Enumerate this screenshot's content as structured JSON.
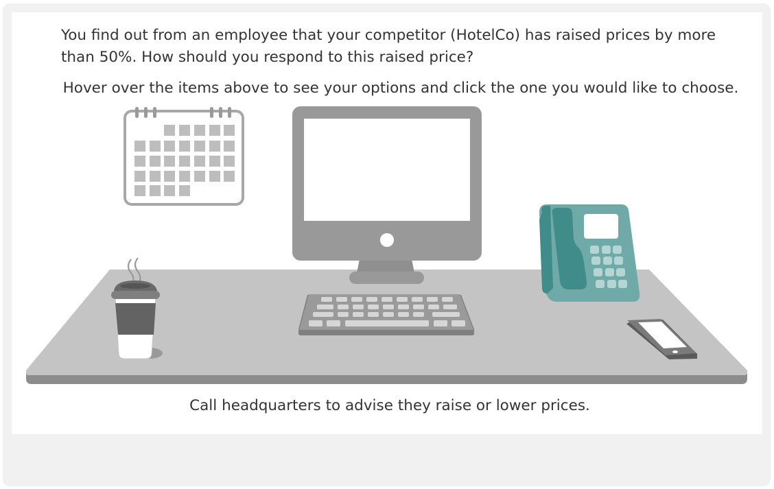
{
  "question": "You find out from an employee that your competitor (HotelCo) has raised prices by more than 50%. How should you respond to this raised price?",
  "instruction": "Hover over the items above to see your options and click the one you would like to choose.",
  "feedback": "Call headquarters to advise they raise or lower prices.",
  "items": {
    "calendar": "calendar-icon",
    "computer": "desktop-computer-icon",
    "keyboard": "keyboard-icon",
    "phone": "desk-phone-icon",
    "coffee": "coffee-cup-icon",
    "mobile": "smartphone-icon"
  },
  "colors": {
    "desk_top": "#c4c4c4",
    "desk_edge": "#8c8c8c",
    "device_gray": "#999999",
    "phone_teal": "#6fa9a8",
    "phone_dark": "#3f8c8b"
  }
}
